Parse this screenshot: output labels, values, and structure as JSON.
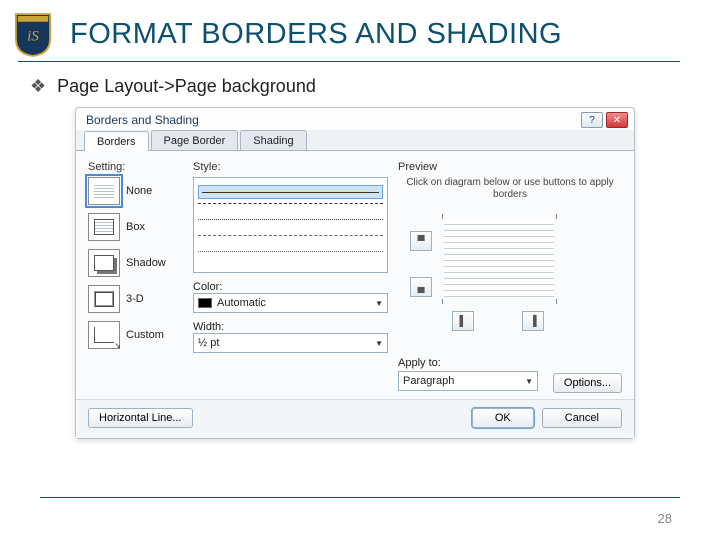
{
  "slide": {
    "title": "FORMAT BORDERS AND SHADING",
    "bullet": "Page Layout->Page background",
    "page_number": "28"
  },
  "dialog": {
    "title": "Borders and Shading",
    "tabs": [
      "Borders",
      "Page Border",
      "Shading"
    ],
    "active_tab": 0,
    "setting": {
      "label": "Setting:",
      "options": [
        "None",
        "Box",
        "Shadow",
        "3-D",
        "Custom"
      ],
      "selected": 0
    },
    "style": {
      "label": "Style:",
      "color_label": "Color:",
      "color_value": "Automatic",
      "width_label": "Width:",
      "width_value": "½ pt"
    },
    "preview": {
      "label": "Preview",
      "hint": "Click on diagram below or use buttons to apply borders",
      "apply_label": "Apply to:",
      "apply_value": "Paragraph",
      "options_btn": "Options..."
    },
    "footer": {
      "hline": "Horizontal Line...",
      "ok": "OK",
      "cancel": "Cancel"
    }
  }
}
